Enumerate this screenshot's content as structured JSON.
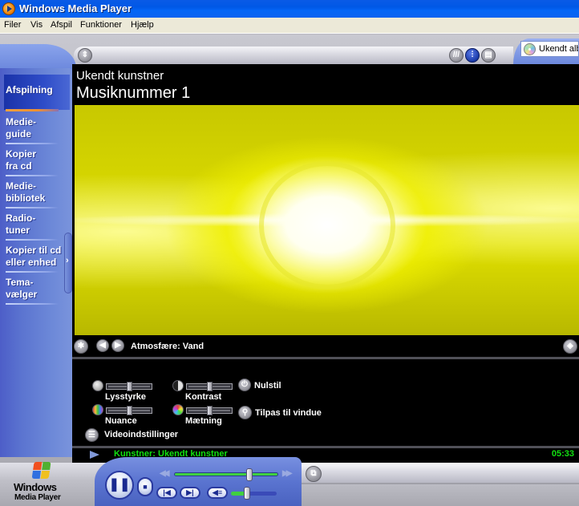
{
  "window": {
    "title": "Windows Media Player"
  },
  "menu": {
    "items": [
      {
        "label": "Filer"
      },
      {
        "label": "Vis"
      },
      {
        "label": "Afspil"
      },
      {
        "label": "Funktioner"
      },
      {
        "label": "Hjælp"
      }
    ]
  },
  "taskbar": {
    "items": [
      {
        "label": "Afspilning",
        "active": true
      },
      {
        "label": "Medie-\nguide"
      },
      {
        "label": "Kopier\nfra cd"
      },
      {
        "label": "Medie-\nbibliotek"
      },
      {
        "label": "Radio-\ntuner"
      },
      {
        "label": "Kopier til cd\neller enhed"
      },
      {
        "label": "Tema-\nvælger"
      }
    ],
    "collapse_glyph": "›"
  },
  "playlist": {
    "current": "Ukendt album"
  },
  "now_playing": {
    "artist": "Ukendt kunstner",
    "track": "Musiknummer 1"
  },
  "visualization": {
    "name": "Atmosfære: Vand"
  },
  "video_settings": {
    "brightness": {
      "label": "Lysstyrke",
      "value": 0.5
    },
    "contrast": {
      "label": "Kontrast",
      "value": 0.5
    },
    "hue": {
      "label": "Nuance",
      "value": 0.5
    },
    "saturation": {
      "label": "Mætning",
      "value": 0.5
    },
    "reset_label": "Nulstil",
    "fit_label": "Tilpas til vindue",
    "menu_label": "Videoindstillinger"
  },
  "status": {
    "text": "Kunstner: Ukendt kunstner",
    "time": "05:33"
  },
  "playback": {
    "seek_fraction": 0.74,
    "volume_fraction": 0.35,
    "state": "playing"
  },
  "logo": {
    "line1": "Windows",
    "line2": "Media Player"
  },
  "colors": {
    "status_green": "#10e010",
    "taskbar_blue": "#5b74d0",
    "titlebar_blue": "#0058e6"
  }
}
